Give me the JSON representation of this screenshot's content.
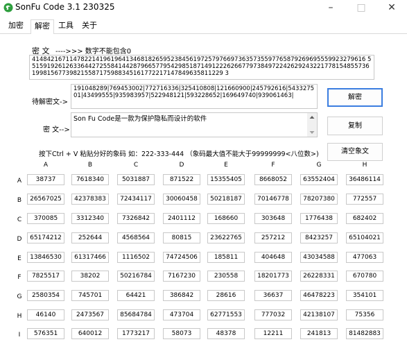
{
  "window": {
    "title": "SonFu Code 3.1 230325",
    "minimize": "–",
    "maximize": "□",
    "close": "✕"
  },
  "tabs": [
    "加密",
    "解密",
    "工具",
    "关于"
  ],
  "decrypt": {
    "cipher_label": "密 文",
    "cipher_hint": "---->>> 数字不能包含0",
    "cipher_text": "41484216711478221419619641346818265952384561972579766973635735597765879269695559923279616 5515919261263364427255841442879665779542985187149122262667797384972242629243221778154855736199815677398215587175988345161772217147849635811229 3",
    "pending_label": "待解密文->",
    "pending_text": "191048289|769453002|772716336|325410808|121660900|245792616|543327501|43499555|935983957|522948121|593228652|169649740|939061463|",
    "decrypt_button": "解密",
    "plain_label": "密 文-->",
    "plain_text": "Son Fu Code是一款为保护隐私而设计的软件",
    "copy_button": "复制",
    "hint_text": "按下Ctrl + V 粘贴分好的象码 如：222-333-444 （象码最大值不能大于99999999<八位数>)",
    "clear_button": "清空象文"
  },
  "grid": {
    "columns": [
      "A",
      "B",
      "C",
      "D",
      "E",
      "F",
      "G",
      "H"
    ],
    "rows": [
      {
        "label": "A",
        "cells": [
          "38737",
          "7618340",
          "5031887",
          "871522",
          "15355405",
          "8668052",
          "63552404",
          "36486114"
        ]
      },
      {
        "label": "B",
        "cells": [
          "26567025",
          "42378383",
          "72434117",
          "30060458",
          "50218187",
          "70146778",
          "78207380",
          "772557"
        ]
      },
      {
        "label": "C",
        "cells": [
          "370085",
          "3312340",
          "7326842",
          "2401112",
          "168660",
          "303648",
          "1776438",
          "682402"
        ]
      },
      {
        "label": "D",
        "cells": [
          "65174212",
          "252644",
          "4568564",
          "80815",
          "23622765",
          "257212",
          "8423257",
          "65104021"
        ]
      },
      {
        "label": "E",
        "cells": [
          "13846530",
          "61317466",
          "1116502",
          "74724506",
          "185811",
          "404648",
          "43034588",
          "477063"
        ]
      },
      {
        "label": "F",
        "cells": [
          "7825517",
          "38202",
          "50216784",
          "7167230",
          "230558",
          "18201773",
          "26228331",
          "670780"
        ]
      },
      {
        "label": "G",
        "cells": [
          "2580354",
          "745701",
          "64421",
          "386842",
          "28616",
          "36637",
          "46478223",
          "354101"
        ]
      },
      {
        "label": "H",
        "cells": [
          "46140",
          "2473567",
          "85684784",
          "473704",
          "62771553",
          "777032",
          "42138107",
          "75356"
        ]
      },
      {
        "label": "I",
        "cells": [
          "576351",
          "640012",
          "1773217",
          "58073",
          "48378",
          "12211",
          "241813",
          "81482883"
        ]
      }
    ]
  },
  "colors": {
    "accent": "#3b7de0",
    "border": "#c8c8c8",
    "icon_green": "#2e9e3e"
  }
}
